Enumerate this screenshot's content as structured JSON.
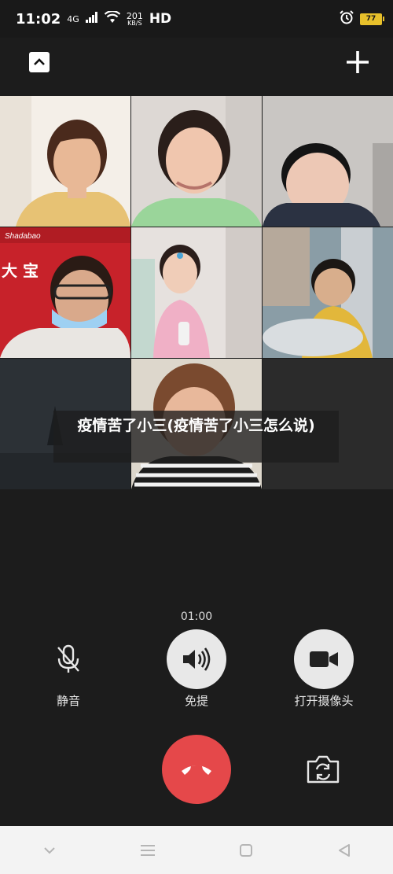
{
  "status_bar": {
    "time": "11:02",
    "network_type": "4G",
    "data_rate_value": "201",
    "data_rate_unit": "KB/S",
    "hd_label": "HD",
    "battery_level": "77"
  },
  "overlay": {
    "title": "疫情苦了小三(疫情苦了小三怎么说)"
  },
  "call": {
    "timer": "01:00",
    "mute_label": "静音",
    "speaker_label": "免提",
    "camera_label": "打开摄像头"
  },
  "participants": [
    {
      "id": "woman-white-room",
      "colors": {
        "bg": "#f4efe8",
        "skin": "#e8b896",
        "hair": "#4a2a1c",
        "shirt": "#e7c274"
      }
    },
    {
      "id": "woman-smiling",
      "colors": {
        "bg": "#ddd8d4",
        "skin": "#f0c6ae",
        "hair": "#2a1e1a",
        "shirt": "#9ad59a"
      }
    },
    {
      "id": "boy-glasses-room",
      "colors": {
        "bg": "#c9c6c3",
        "skin": "#edc8b5",
        "hair": "#141414",
        "shirt": "#2b3242"
      }
    },
    {
      "id": "woman-red-wall",
      "colors": {
        "bg": "#c7222a",
        "skin": "#d9a98b",
        "hair": "#2a1b15",
        "shirt": "#e9e6e2"
      }
    },
    {
      "id": "girl-pink",
      "colors": {
        "bg": "#e6e1de",
        "skin": "#f0cdb8",
        "hair": "#2b1e1b",
        "shirt": "#f0b0c6"
      }
    },
    {
      "id": "boy-shop",
      "colors": {
        "bg": "#8a9da6",
        "skin": "#d8ae8c",
        "hair": "#1b1714",
        "shirt": "#e2b73b"
      }
    },
    {
      "id": "dark-landscape",
      "colors": {
        "bg": "#2c3136",
        "skin": "",
        "hair": "",
        "shirt": ""
      }
    },
    {
      "id": "girl-striped",
      "colors": {
        "bg": "#ddd7cc",
        "skin": "#e8b89b",
        "hair": "#7a4a2f",
        "shirt": "#1c1c1c"
      }
    }
  ],
  "accents": {
    "hangup": "#e5484a",
    "active_control": "#e8e8e8",
    "battery": "#e7c02b"
  }
}
